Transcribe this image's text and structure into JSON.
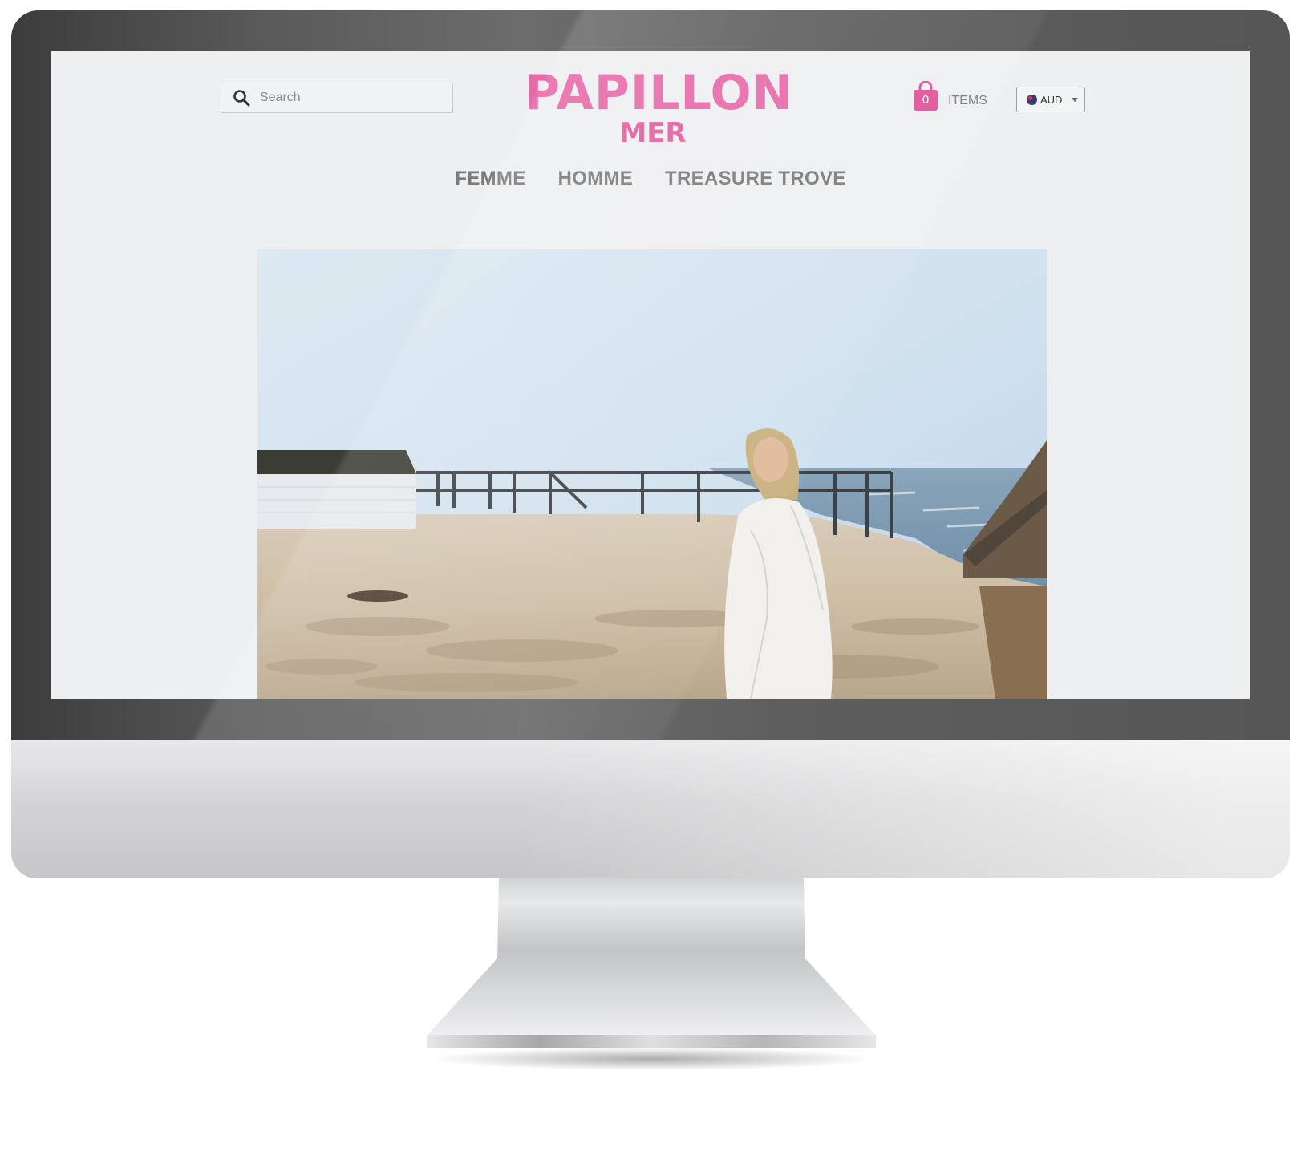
{
  "header": {
    "search": {
      "placeholder": "Search"
    },
    "logo": {
      "main": "PAPILLON",
      "sub": "MER"
    },
    "cart": {
      "count": "0",
      "label": "ITEMS"
    },
    "currency": {
      "selected": "AUD"
    }
  },
  "nav": {
    "items": [
      "FEMME",
      "HOMME",
      "TREASURE TROVE"
    ]
  },
  "colors": {
    "brand_pink": "#e769a8",
    "nav_text": "#7b7b7b",
    "screen_bg": "#eeeff1"
  },
  "icons": {
    "search": "search-icon",
    "cart": "shopping-bag-icon",
    "currency_flag": "flag-icon",
    "dropdown": "caret-down-icon"
  }
}
